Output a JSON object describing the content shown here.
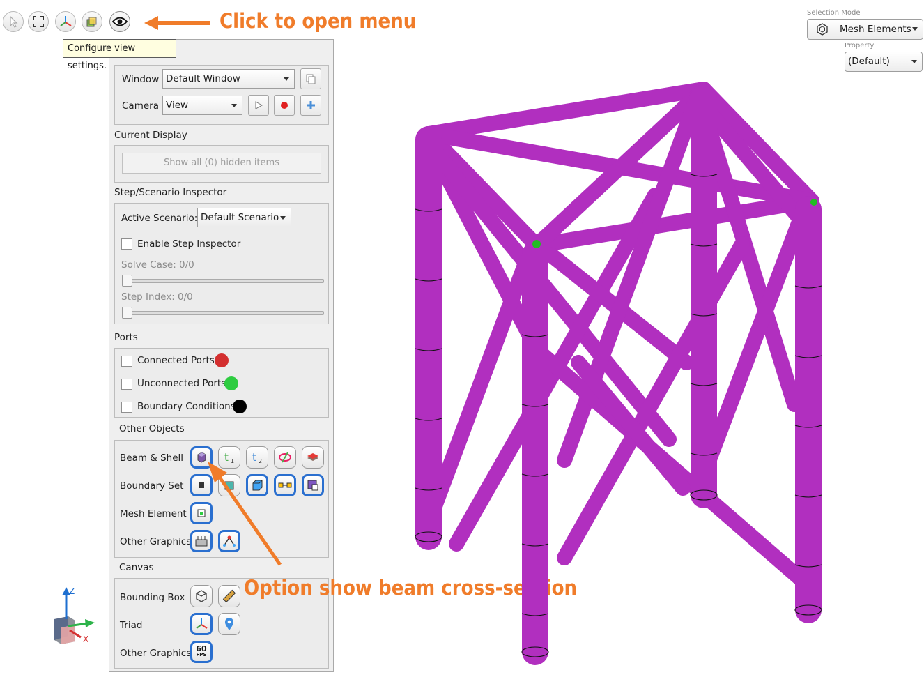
{
  "tooltip": "Configure view settings.",
  "toolbar": {
    "buttons": [
      {
        "name": "select-mode-icon"
      },
      {
        "name": "fit-view-icon"
      },
      {
        "name": "triad-view-icon"
      },
      {
        "name": "display-mode-icon"
      },
      {
        "name": "view-settings-eye-icon"
      }
    ]
  },
  "annotations": {
    "click_menu": "Click to open menu",
    "beam_section": "Option show beam cross-section",
    "color": "#f07c2a"
  },
  "view_panel": {
    "window_label": "Window",
    "window_value": "Default Window",
    "camera_label": "Camera",
    "camera_value": "View",
    "current_display": "Current Display",
    "show_hidden": "Show all (0) hidden items",
    "step_inspector": "Step/Scenario Inspector",
    "active_scenario_label": "Active Scenario:",
    "active_scenario_value": "Default Scenario",
    "enable_step_inspector": "Enable Step Inspector",
    "solve_case": "Solve Case: 0/0",
    "step_index": "Step Index: 0/0",
    "ports": "Ports",
    "connected_ports": "Connected Ports",
    "unconnected_ports": "Unconnected Ports",
    "boundary_conditions": "Boundary Conditions",
    "other_objects": "Other Objects",
    "beam_shell": "Beam & Shell",
    "boundary_set": "Boundary Set",
    "mesh_element": "Mesh Element",
    "other_graphics": "Other Graphics",
    "canvas": "Canvas",
    "bounding_box": "Bounding Box",
    "triad": "Triad",
    "canvas_other_graphics": "Other Graphics",
    "fps_top": "60",
    "fps_bottom": "FPS",
    "colors": {
      "connected": "#d32f2f",
      "unconnected": "#2ecc40",
      "boundary": "#000000",
      "accent": "#2a6fcf"
    }
  },
  "selection": {
    "mode_label": "Selection Mode",
    "mode_value": "Mesh Elements",
    "property_label": "Property",
    "property_value": "(Default)"
  },
  "axes": {
    "z": "Z",
    "x": "X"
  },
  "model": {
    "beam_color": "#b12fbf",
    "node_color": "#22bb22"
  }
}
